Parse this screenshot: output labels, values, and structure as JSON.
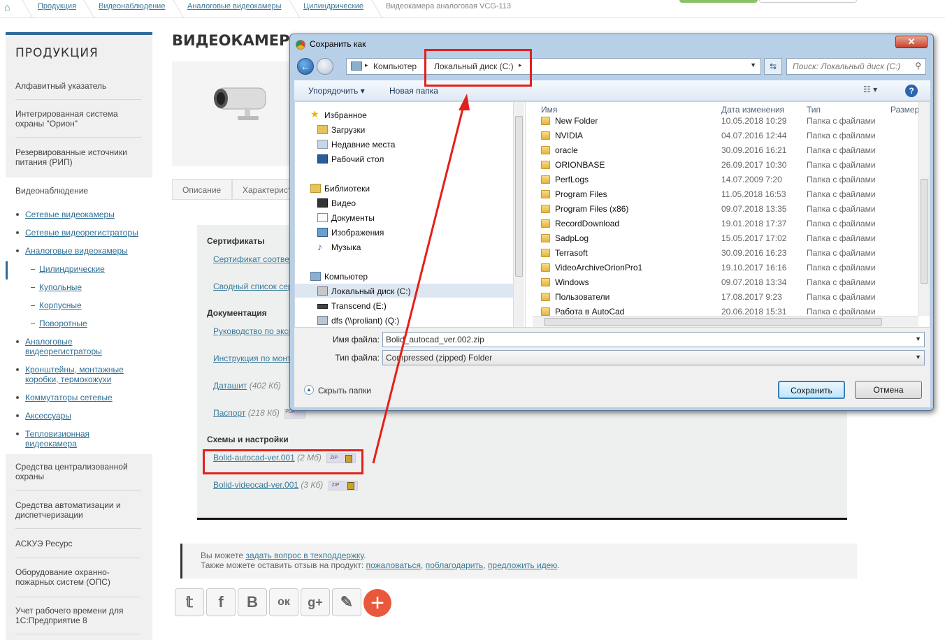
{
  "breadcrumb": [
    "Продукция",
    "Видеонаблюдение",
    "Аналоговые видеокамеры",
    "Цилиндрические",
    "Видеокамера аналоговая VCG-113"
  ],
  "sidebar": {
    "title": "ПРОДУКЦИЯ",
    "items": [
      "Алфавитный указатель",
      "Интегрированная система охраны \"Орион\"",
      "Резервированные источники питания (РИП)",
      "Видеонаблюдение"
    ],
    "video_sub": [
      "Сетевые видеокамеры",
      "Сетевые видеорегистраторы",
      "Аналоговые видеокамеры"
    ],
    "analog_sub": [
      "Цилиндрические",
      "Купольные",
      "Корпусные",
      "Поворотные"
    ],
    "video_sub2": [
      "Аналоговые видеорегистраторы",
      "Кронштейны, монтажные коробки, термокожухи",
      "Коммутаторы сетевые",
      "Аксессуары",
      "Тепловизионная видеокамера"
    ],
    "bottom_items": [
      "Средства централизованной охраны",
      "Средства автоматизации и диспетчеризации",
      "АСКУЭ Ресурс",
      "Оборудование охранно-пожарных систем (ОПС)",
      "Учет рабочего времени для 1С:Предприятие 8"
    ]
  },
  "main": {
    "title": "ВИДЕОКАМЕРА АНАЛОГОВАЯ VCG-113",
    "tabs": [
      "Описание",
      "Характеристики"
    ],
    "sections": {
      "certs": "Сертификаты",
      "docs": "Документация",
      "schemes": "Схемы и настройки"
    },
    "cert_links": [
      "Сертификат соответствия",
      "Сводный список сертификатов"
    ],
    "doc_links": [
      {
        "label": "Руководство по эксплуатации",
        "meta": ""
      },
      {
        "label": "Инструкция по монтажу",
        "meta": ""
      },
      {
        "label": "Даташит",
        "meta": "(402 Кб)"
      },
      {
        "label": "Паспорт",
        "meta": "(218 Кб)"
      }
    ],
    "scheme_links": [
      {
        "label": "Bolid-autocad-ver.001",
        "meta": "(2 Мб)"
      },
      {
        "label": "Bolid-videocad-ver.001",
        "meta": "(3 Кб)"
      }
    ],
    "badge_zip": "ZIP",
    "badge_pdf": "PDF"
  },
  "support": {
    "line1_prefix": "Вы можете ",
    "line1_link": "задать вопрос в техподдержку",
    "line1_suffix": ".",
    "line2_prefix": "Также можете оставить отзыв на продукт: ",
    "link_complain": "пожаловаться",
    "link_thank": "поблагодарить",
    "link_suggest": "предложить идею",
    "comma": ", ",
    "dot": "."
  },
  "social": [
    "twitter-icon",
    "facebook-icon",
    "vk-icon",
    "odnoklassniki-icon",
    "googleplus-icon",
    "edit-icon"
  ],
  "social_glyphs": [
    "𝕥",
    "f",
    "B",
    "ок",
    "g+",
    "✎",
    "+"
  ],
  "dialog": {
    "title": "Сохранить как",
    "close": "✕",
    "addr_computer": "Компьютер",
    "addr_disk": "Локальный диск (C:)",
    "search_placeholder": "Поиск: Локальный диск (C:)",
    "organize": "Упорядочить ▾",
    "new_folder": "Новая папка",
    "help": "?",
    "nav": {
      "favorites": "Избранное",
      "downloads": "Загрузки",
      "recent": "Недавние места",
      "desktop": "Рабочий стол",
      "libraries": "Библиотеки",
      "video": "Видео",
      "documents": "Документы",
      "images": "Изображения",
      "music": "Музыка",
      "computer": "Компьютер",
      "local_disk": "Локальный диск (C:)",
      "transcend": "Transcend (E:)",
      "dfs": "dfs (\\\\proliant) (Q:)"
    },
    "columns": {
      "name": "Имя",
      "date": "Дата изменения",
      "type": "Тип",
      "size": "Размер"
    },
    "files": [
      {
        "name": "New Folder",
        "date": "10.05.2018 10:29",
        "type": "Папка с файлами"
      },
      {
        "name": "NVIDIA",
        "date": "04.07.2016 12:44",
        "type": "Папка с файлами"
      },
      {
        "name": "oracle",
        "date": "30.09.2016 16:21",
        "type": "Папка с файлами"
      },
      {
        "name": "ORIONBASE",
        "date": "26.09.2017 10:30",
        "type": "Папка с файлами"
      },
      {
        "name": "PerfLogs",
        "date": "14.07.2009 7:20",
        "type": "Папка с файлами"
      },
      {
        "name": "Program Files",
        "date": "11.05.2018 16:53",
        "type": "Папка с файлами"
      },
      {
        "name": "Program Files (x86)",
        "date": "09.07.2018 13:35",
        "type": "Папка с файлами"
      },
      {
        "name": "RecordDownload",
        "date": "19.01.2018 17:37",
        "type": "Папка с файлами"
      },
      {
        "name": "SadpLog",
        "date": "15.05.2017 17:02",
        "type": "Папка с файлами"
      },
      {
        "name": "Terrasoft",
        "date": "30.09.2016 16:23",
        "type": "Папка с файлами"
      },
      {
        "name": "VideoArchiveOrionPro1",
        "date": "19.10.2017 16:16",
        "type": "Папка с файлами"
      },
      {
        "name": "Windows",
        "date": "09.07.2018 13:34",
        "type": "Папка с файлами"
      },
      {
        "name": "Пользователи",
        "date": "17.08.2017 9:23",
        "type": "Папка с файлами"
      },
      {
        "name": "Работа в AutoCad",
        "date": "20.06.2018 15:31",
        "type": "Папка с файлами"
      }
    ],
    "filename_label": "Имя файла:",
    "filename_value": "Bolid_autocad_ver.002.zip",
    "filetype_label": "Тип файла:",
    "filetype_value": "Compressed (zipped) Folder",
    "hide_folders": "Скрыть папки",
    "save": "Сохранить",
    "cancel": "Отмена"
  },
  "colors": {
    "accent": "#2c6a99",
    "highlight": "#e3201b",
    "plus": "#e8583a"
  }
}
